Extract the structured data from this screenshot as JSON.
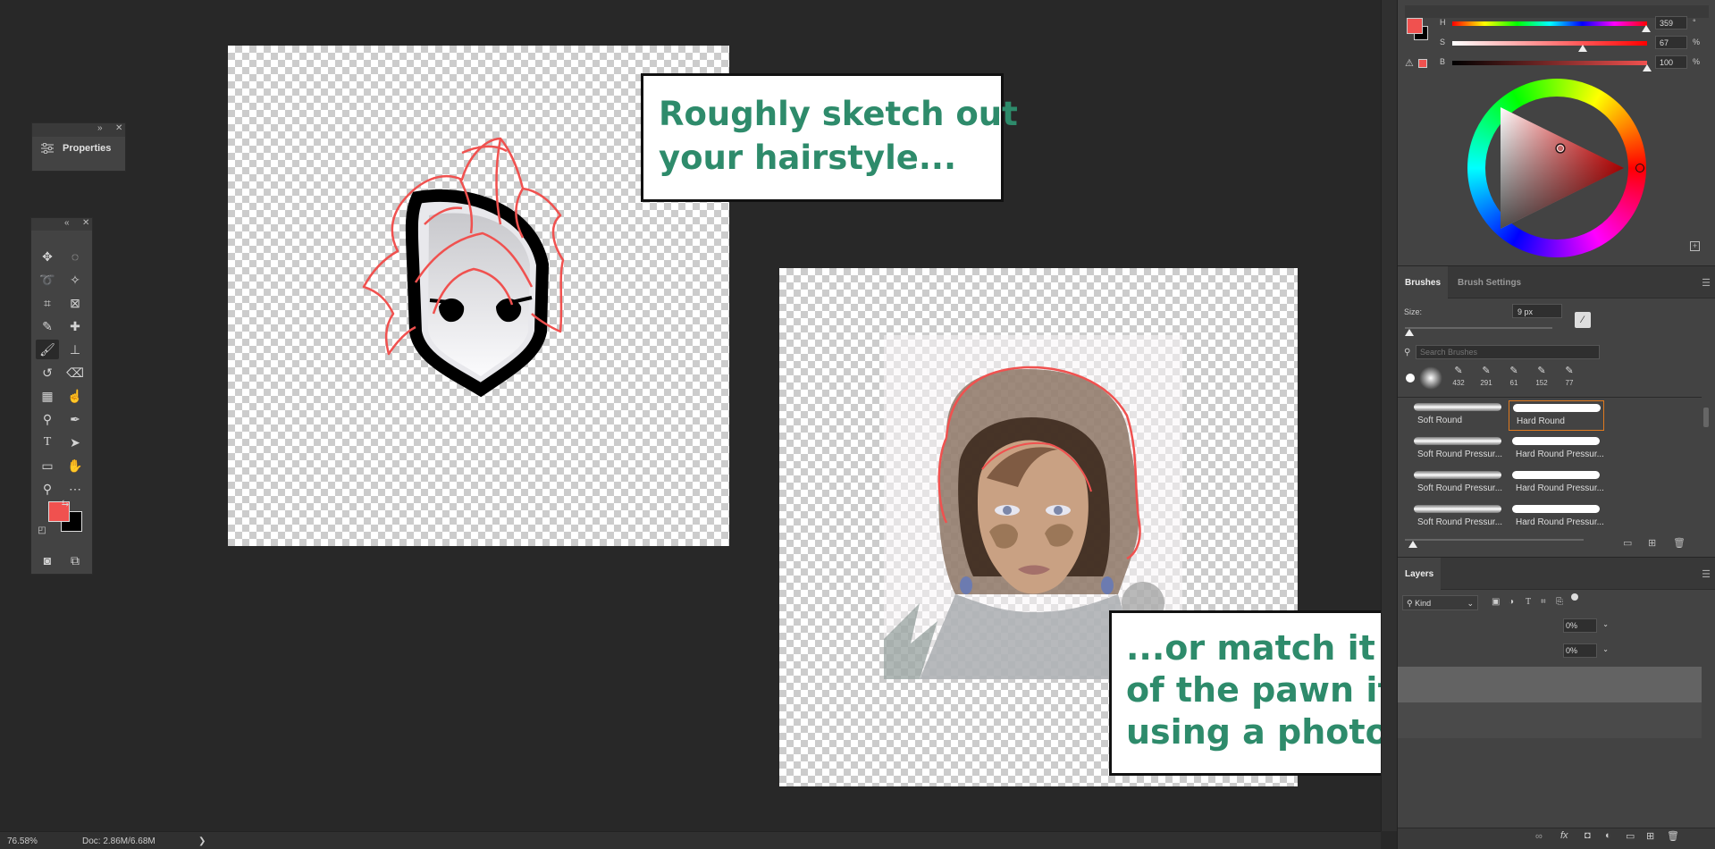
{
  "panels": {
    "properties": {
      "title": "Properties"
    }
  },
  "color": {
    "foreground": "#f0514f",
    "background": "#000000",
    "sliders": [
      {
        "label": "H",
        "value": "359",
        "unit": "°",
        "level": 0.997
      },
      {
        "label": "S",
        "value": "67",
        "unit": "%",
        "level": 0.67
      },
      {
        "label": "B",
        "value": "100",
        "unit": "%",
        "level": 1.0
      }
    ]
  },
  "brushes": {
    "tabs": [
      "Brushes",
      "Brush Settings"
    ],
    "size_label": "Size:",
    "size_value": "9 px",
    "search_placeholder": "Search Brushes",
    "recent": [
      "432",
      "291",
      "61",
      "152",
      "77"
    ],
    "items": [
      {
        "name": "Soft Round",
        "hard": false,
        "selected": false
      },
      {
        "name": "Hard Round",
        "hard": true,
        "selected": true
      },
      {
        "name": "Soft Round Pressur...",
        "hard": false,
        "selected": false
      },
      {
        "name": "Hard Round Pressur...",
        "hard": true,
        "selected": false
      },
      {
        "name": "Soft Round Pressur...",
        "hard": false,
        "selected": false
      },
      {
        "name": "Hard Round Pressur...",
        "hard": true,
        "selected": false
      },
      {
        "name": "Soft Round Pressur...",
        "hard": false,
        "selected": false
      },
      {
        "name": "Hard Round Pressur...",
        "hard": true,
        "selected": false
      }
    ]
  },
  "layers": {
    "title": "Layers",
    "filter_label": "Kind",
    "opacity_1": "0%",
    "opacity_2": "0%"
  },
  "callouts": {
    "first": [
      "Roughly sketch out",
      "your hairstyle..."
    ],
    "second": [
      "...or match it to the head",
      "of the pawn if you’re",
      "using a photo reference."
    ]
  },
  "status": {
    "zoom": "76.58%",
    "doc": "Doc: 2.86M/6.68M",
    "arrow": "❯"
  },
  "accent": {
    "sketch_red": "#f0514f",
    "callout_green": "#2e8b6b",
    "selection_orange": "#e07a1f"
  }
}
